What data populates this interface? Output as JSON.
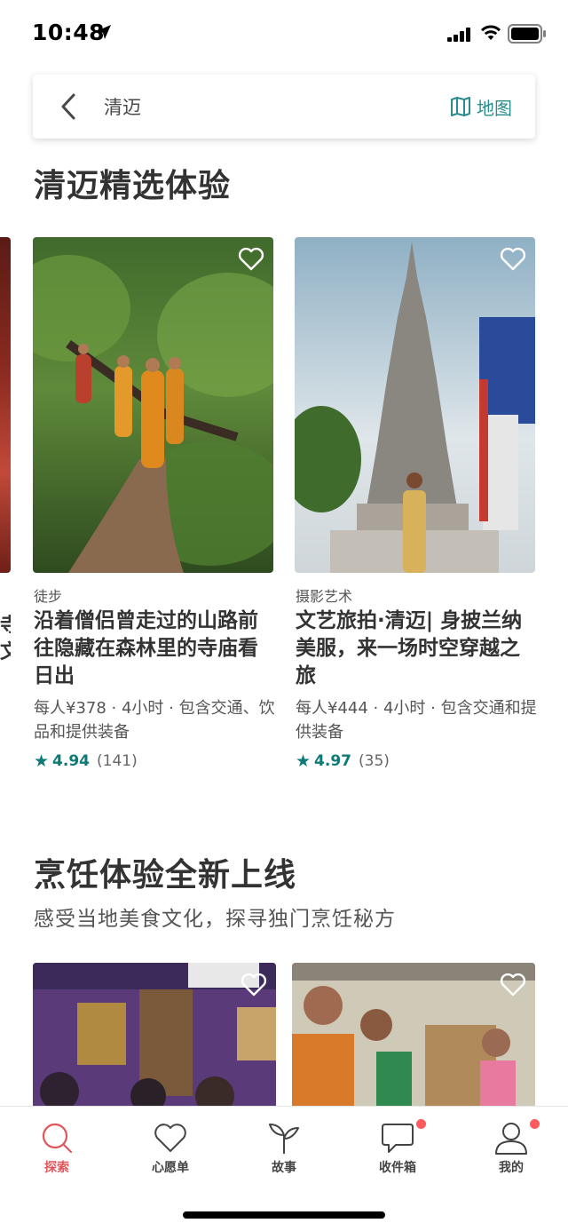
{
  "status_bar": {
    "time": "10:48"
  },
  "search_bar": {
    "query": "清迈",
    "map_label": "地图"
  },
  "section1": {
    "title": "清迈精选体验",
    "partial_card": {
      "title_fragment1": "寺",
      "title_fragment2": "文"
    },
    "cards": [
      {
        "category": "徒步",
        "title": "沿着僧侣曾走过的山路前往隐藏在森林里的寺庙看日出",
        "meta": "每人¥378 · 4小时 · 包含交通、饮品和提供装备",
        "score": "4.94",
        "count": "(141)"
      },
      {
        "category": "摄影艺术",
        "title": "文艺旅拍·清迈| 身披兰纳美服，来一场时空穿越之旅",
        "meta": "每人¥444 · 4小时 · 包含交通和提供装备",
        "score": "4.97",
        "count": "(35)"
      }
    ]
  },
  "section2": {
    "title": "烹饪体验全新上线",
    "subtitle": "感受当地美食文化，探寻独门烹饪秘方"
  },
  "tabs": [
    {
      "label": "探索",
      "icon": "search-icon",
      "active": true
    },
    {
      "label": "心愿单",
      "icon": "heart-icon",
      "active": false
    },
    {
      "label": "故事",
      "icon": "sprout-icon",
      "active": false
    },
    {
      "label": "收件箱",
      "icon": "message-icon",
      "active": false,
      "badge": true
    },
    {
      "label": "我的",
      "icon": "profile-icon",
      "active": false,
      "badge": true
    }
  ],
  "colors": {
    "accent": "#ff5a5f",
    "teal": "#2a8c8c",
    "rating": "#0d7a78"
  }
}
